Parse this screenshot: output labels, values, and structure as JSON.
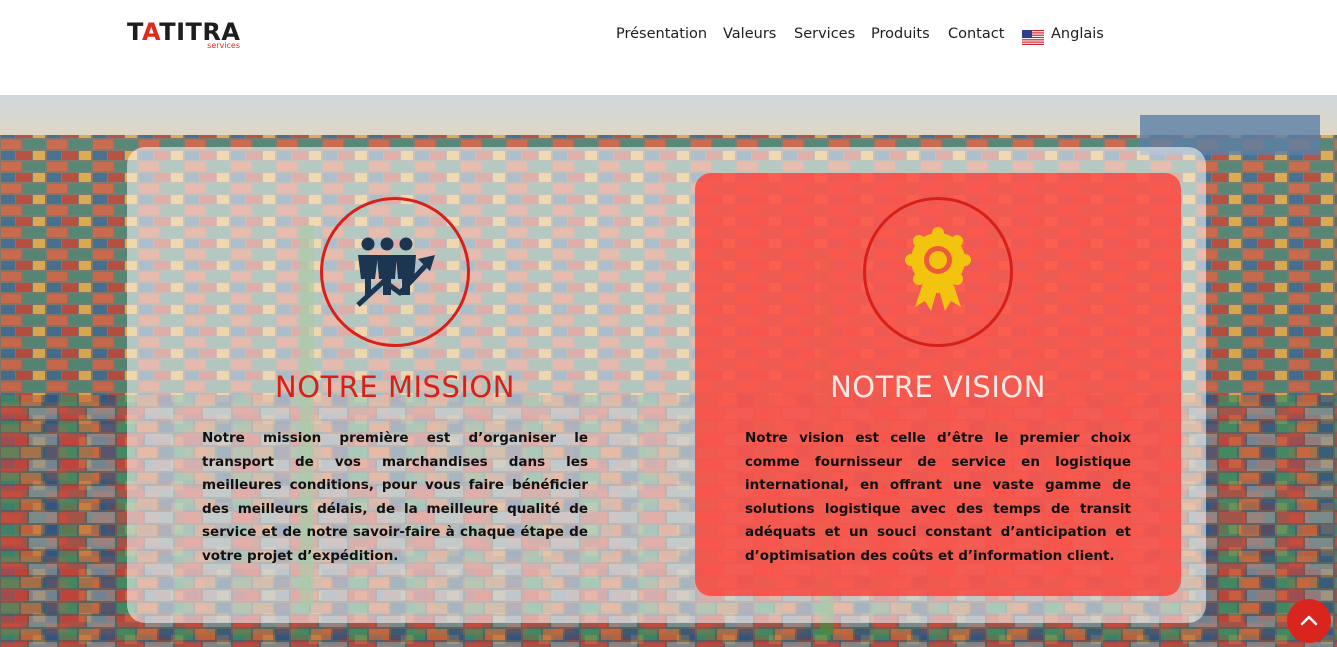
{
  "brand": {
    "name_prefix": "T",
    "name_accent": "A",
    "name_suffix": "TITRA",
    "tagline": "services"
  },
  "nav": {
    "items": [
      {
        "label": "Présentation"
      },
      {
        "label": "Valeurs"
      },
      {
        "label": "Services"
      },
      {
        "label": "Produits"
      },
      {
        "label": "Contact"
      }
    ],
    "language": {
      "label": "Anglais",
      "icon": "us-flag-icon"
    }
  },
  "mission": {
    "title": "NOTRE MISSION",
    "icon": "team-growth-icon",
    "text": "Notre mission première est d’organiser le transport de vos marchandises dans les meilleures conditions, pour vous faire bénéficier des meilleurs délais, de la meilleure qualité de service et de notre savoir-faire à chaque étape de votre projet d’expédition."
  },
  "vision": {
    "title": "NOTRE VISION",
    "icon": "award-ribbon-icon",
    "text": "Notre vision est celle d’être le premier choix comme fournisseur de service en logistique international, en offrant une vaste gamme de solutions logistique avec des temps de transit adéquats et un souci constant d’anticipation et d’optimisation des coûts et d’information client."
  },
  "scroll_top": {
    "icon": "chevron-up-icon"
  },
  "colors": {
    "accent": "#d9251d",
    "mission_title": "#d7201a",
    "vision_title": "#fde8e4",
    "icon_navy": "#1c3550",
    "icon_gold": "#f2c40f"
  }
}
